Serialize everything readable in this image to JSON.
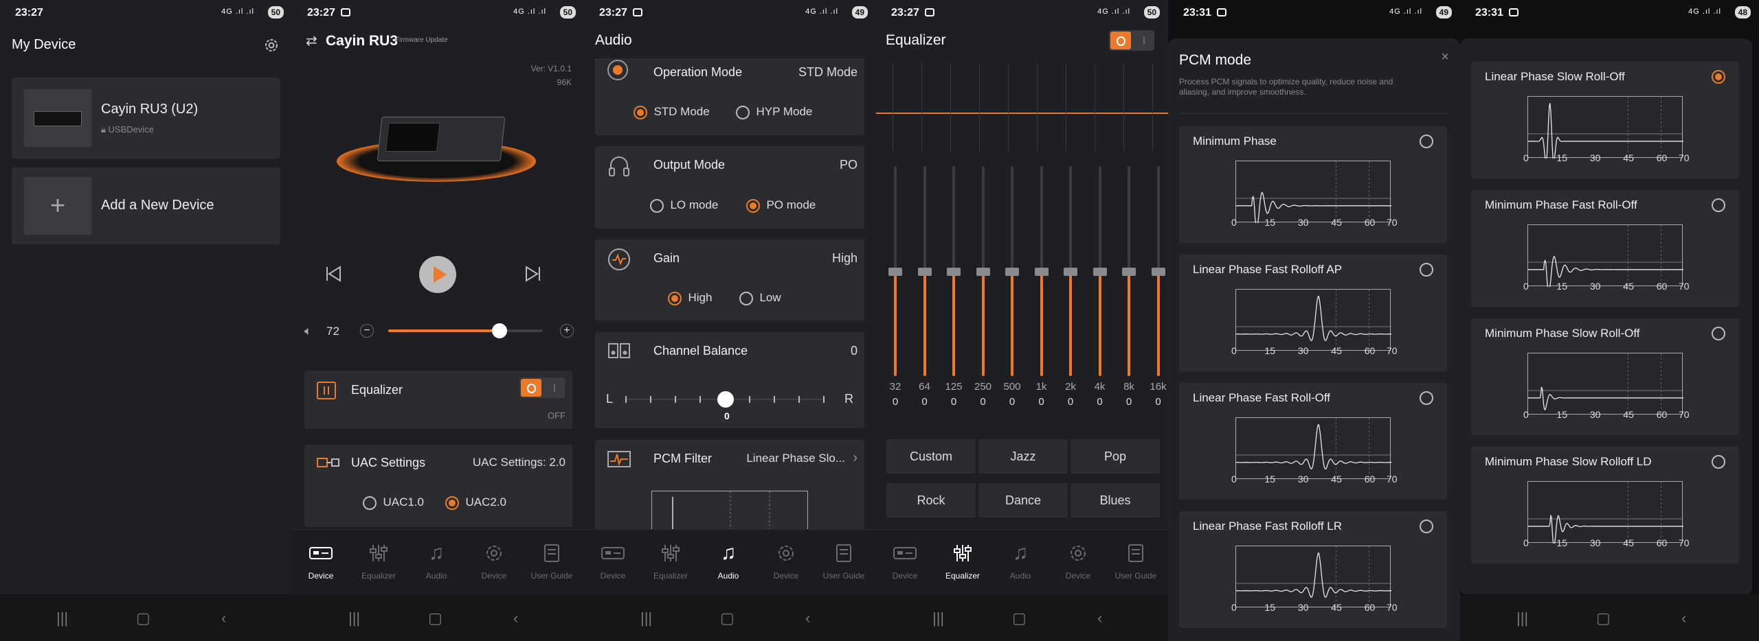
{
  "p1": {
    "time": "23:27",
    "batt": "50",
    "title": "My Device",
    "device_name": "Cayin RU3 (U2)",
    "device_sub": "USBDevice",
    "add_label": "Add a New Device"
  },
  "p2": {
    "time": "23:27",
    "batt": "50",
    "title": "Cayin RU3",
    "firmware": "Firmware Update",
    "ver": "Ver: V1.0.1",
    "rate": "96K",
    "volume": "72",
    "volume_fraction": 0.72,
    "eq_label": "Equalizer",
    "eq_state": "OFF",
    "uac_title": "UAC Settings",
    "uac_value": "UAC Settings: 2.0",
    "uac1": "UAC1.0",
    "uac2": "UAC2.0"
  },
  "p3": {
    "time": "23:27",
    "batt": "49",
    "title": "Audio",
    "op_label": "Operation Mode",
    "op_value": "STD Mode",
    "std": "STD Mode",
    "hyp": "HYP Mode",
    "out_label": "Output Mode",
    "out_value": "PO",
    "lo": "LO mode",
    "po": "PO mode",
    "gain_label": "Gain",
    "gain_value": "High",
    "high": "High",
    "low": "Low",
    "bal_label": "Channel Balance",
    "bal_value": "0",
    "bal_l": "L",
    "bal_r": "R",
    "bal_pos": "0",
    "pcm_label": "PCM Filter",
    "pcm_value": "Linear Phase Slo..."
  },
  "p4": {
    "time": "23:27",
    "batt": "50",
    "title": "Equalizer",
    "bands": [
      "32",
      "64",
      "125",
      "250",
      "500",
      "1k",
      "2k",
      "4k",
      "8k",
      "16k"
    ],
    "gains": [
      "0",
      "0",
      "0",
      "0",
      "0",
      "0",
      "0",
      "0",
      "0",
      "0"
    ],
    "presets": [
      "Custom",
      "Jazz",
      "Pop",
      "Rock",
      "Dance",
      "Blues"
    ]
  },
  "p5": {
    "time": "23:31",
    "batt": "49",
    "title": "PCM mode",
    "desc1": "Process PCM signals to optimize quality, reduce noise and",
    "desc2": "aliasing, and improve smoothness.",
    "filters": [
      "Minimum Phase",
      "Linear Phase Fast Rolloff AP",
      "Linear Phase Fast Roll-Off",
      "Linear Phase Fast Rolloff LR"
    ]
  },
  "p6": {
    "time": "23:31",
    "batt": "48",
    "filters": [
      "Linear Phase Slow Roll-Off",
      "Minimum Phase Fast Roll-Off",
      "Minimum Phase Slow Roll-Off",
      "Minimum Phase Slow Rolloff LD"
    ]
  },
  "axis_ticks": [
    "0",
    "15",
    "30",
    "45",
    "60",
    "70"
  ],
  "tabs": [
    "Device",
    "Equalizer",
    "Audio",
    "Device",
    "User Guide"
  ],
  "colors": {
    "accent": "#ec7a2c",
    "bg": "#1e1f22",
    "card": "#2b2c30"
  }
}
